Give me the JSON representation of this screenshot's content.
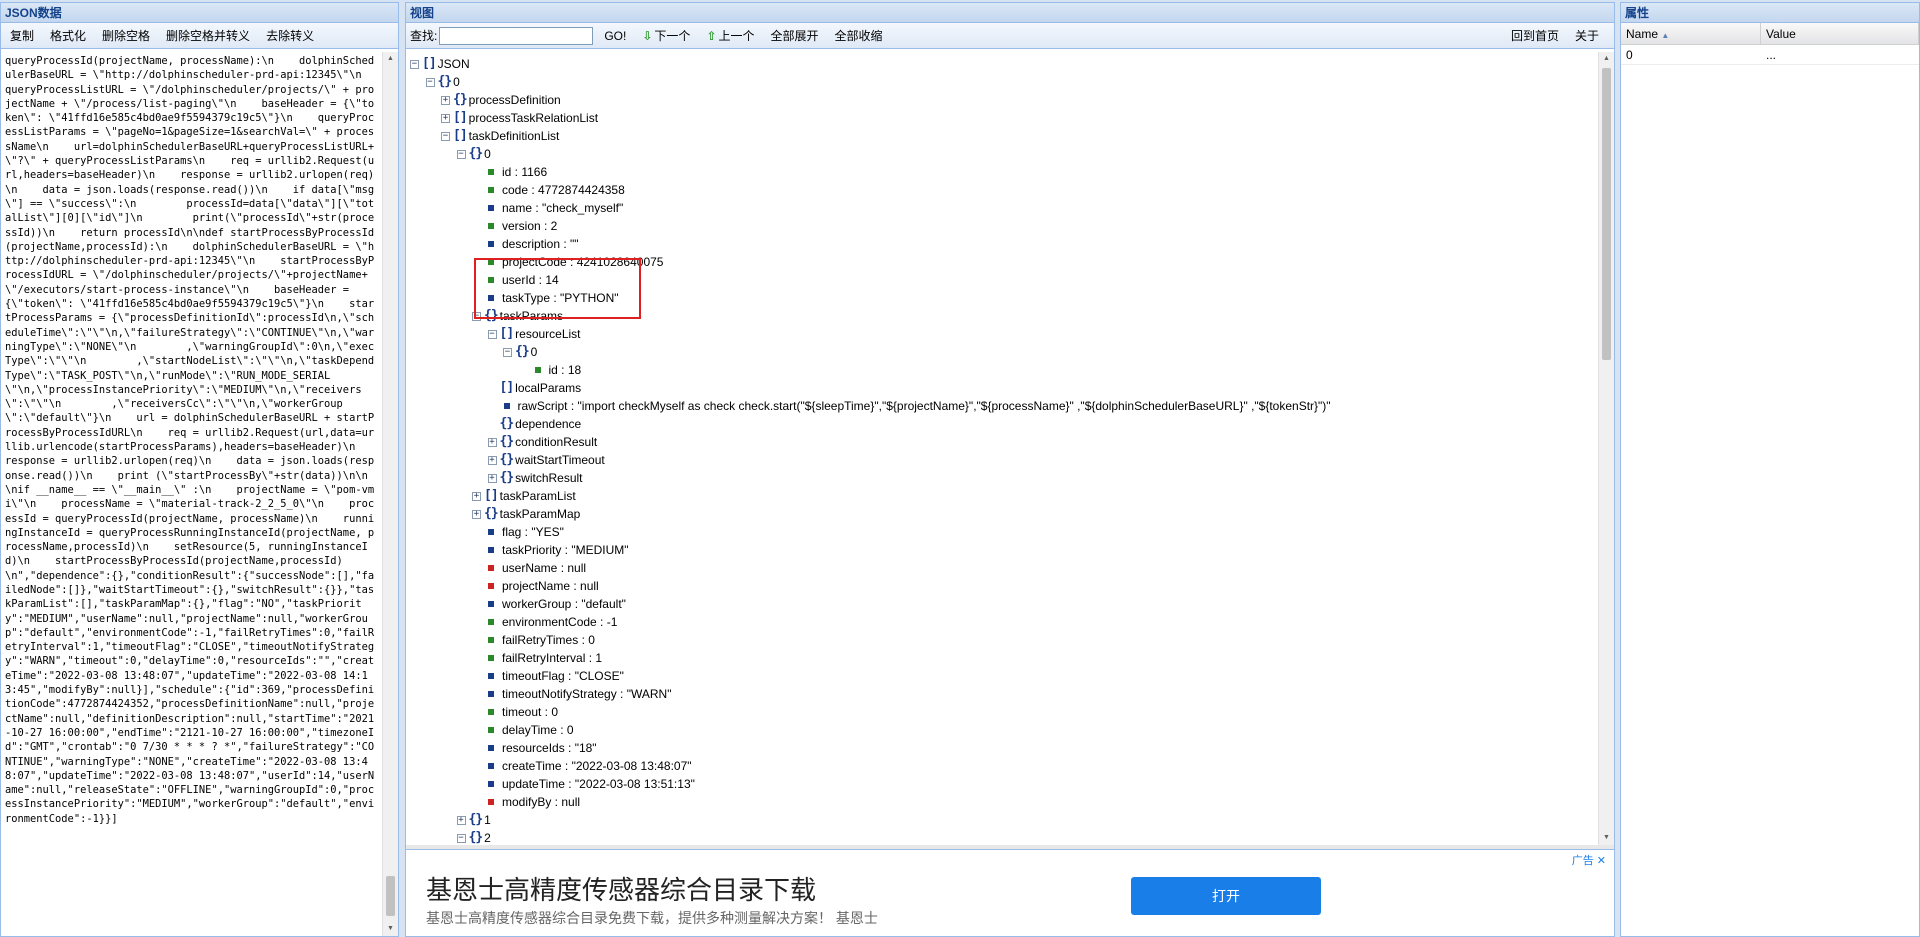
{
  "left_panel": {
    "title": "JSON数据",
    "toolbar": [
      "复制",
      "格式化",
      "删除空格",
      "删除空格并转义",
      "去除转义"
    ],
    "text": "queryProcessId(projectName, processName):\\n    dolphinSchedulerBaseURL = \\\"http://dolphinscheduler-prd-api:12345\\\"\\n    queryProcessListURL = \\\"/dolphinscheduler/projects/\\\" + projectName + \\\"/process/list-paging\\\"\\n    baseHeader = {\\\"token\\\": \\\"41ffd16e585c4bd0ae9f5594379c19c5\\\"}\\n    queryProcessListParams = \\\"pageNo=1&pageSize=1&searchVal=\\\" + processName\\n    url=dolphinSchedulerBaseURL+queryProcessListURL+\\\"?\\\" + queryProcessListParams\\n    req = urllib2.Request(url,headers=baseHeader)\\n    response = urllib2.urlopen(req)\\n    data = json.loads(response.read())\\n    if data[\\\"msg\\\"] == \\\"success\\\":\\n        processId=data[\\\"data\\\"][\\\"totalList\\\"][0][\\\"id\\\"]\\n        print(\\\"processId\\\"+str(processId))\\n    return processId\\n\\ndef startProcessByProcessId(projectName,processId):\\n    dolphinSchedulerBaseURL = \\\"http://dolphinscheduler-prd-api:12345\\\"\\n    startProcessByProcessIdURL = \\\"/dolphinscheduler/projects/\\\"+projectName+\\\"/executors/start-process-instance\\\"\\n    baseHeader = {\\\"token\\\": \\\"41ffd16e585c4bd0ae9f5594379c19c5\\\"}\\n    startProcessParams = {\\\"processDefinitionId\\\":processId\\n,\\\"scheduleTime\\\":\\\"\\\"\\n,\\\"failureStrategy\\\":\\\"CONTINUE\\\"\\n,\\\"warningType\\\":\\\"NONE\\\"\\n        ,\\\"warningGroupId\\\":0\\n,\\\"execType\\\":\\\"\\\"\\n        ,\\\"startNodeList\\\":\\\"\\\"\\n,\\\"taskDependType\\\":\\\"TASK_POST\\\"\\n,\\\"runMode\\\":\\\"RUN_MODE_SERIAL\\\"\\n,\\\"processInstancePriority\\\":\\\"MEDIUM\\\"\\n,\\\"receivers\\\":\\\"\\\"\\n        ,\\\"receiversCc\\\":\\\"\\\"\\n,\\\"workerGroup\\\":\\\"default\\\"}\\n    url = dolphinSchedulerBaseURL + startProcessByProcessIdURL\\n    req = urllib2.Request(url,data=urllib.urlencode(startProcessParams),headers=baseHeader)\\n    response = urllib2.urlopen(req)\\n    data = json.loads(response.read())\\n    print (\\\"startProcessBy\\\"+str(data))\\n\\n\\nif __name__ == \\\"__main__\\\" :\\n    projectName = \\\"pom-vmi\\\"\\n    processName = \\\"material-track-2_2_5_0\\\"\\n    processId = queryProcessId(projectName, processName)\\n    runningInstanceId = queryProcessRunningInstanceId(projectName, processName,processId)\\n    setResource(5, runningInstanceId)\\n    startProcessByProcessId(projectName,processId)\\n\",\"dependence\":{},\"conditionResult\":{\"successNode\":[],\"failedNode\":[]},\"waitStartTimeout\":{},\"switchResult\":{}},\"taskParamList\":[],\"taskParamMap\":{},\"flag\":\"NO\",\"taskPriority\":\"MEDIUM\",\"userName\":null,\"projectName\":null,\"workerGroup\":\"default\",\"environmentCode\":-1,\"failRetryTimes\":0,\"failRetryInterval\":1,\"timeoutFlag\":\"CLOSE\",\"timeoutNotifyStrategy\":\"WARN\",\"timeout\":0,\"delayTime\":0,\"resourceIds\":\"\",\"createTime\":\"2022-03-08 13:48:07\",\"updateTime\":\"2022-03-08 14:13:45\",\"modifyBy\":null}],\"schedule\":{\"id\":369,\"processDefinitionCode\":4772874424352,\"processDefinitionName\":null,\"projectName\":null,\"definitionDescription\":null,\"startTime\":\"2021-10-27 16:00:00\",\"endTime\":\"2121-10-27 16:00:00\",\"timezoneId\":\"GMT\",\"crontab\":\"0 7/30 * * * ? *\",\"failureStrategy\":\"CONTINUE\",\"warningType\":\"NONE\",\"createTime\":\"2022-03-08 13:48:07\",\"updateTime\":\"2022-03-08 13:48:07\",\"userId\":14,\"userName\":null,\"releaseState\":\"OFFLINE\",\"warningGroupId\":0,\"processInstancePriority\":\"MEDIUM\",\"workerGroup\":\"default\",\"environmentCode\":-1}}]"
  },
  "center_panel": {
    "title": "视图",
    "search_label": "查找:",
    "search_value": "",
    "go_label": "GO!",
    "next_label": "下一个",
    "prev_label": "上一个",
    "expand_all": "全部展开",
    "collapse_all": "全部收缩",
    "home_label": "回到首页",
    "about_label": "关于",
    "tree": [
      {
        "d": 0,
        "t": "-",
        "k": "arr",
        "l": "JSON"
      },
      {
        "d": 1,
        "t": "-",
        "k": "obj",
        "l": "0"
      },
      {
        "d": 2,
        "t": "+",
        "k": "obj",
        "l": "processDefinition"
      },
      {
        "d": 2,
        "t": "+",
        "k": "arr",
        "l": "processTaskRelationList"
      },
      {
        "d": 2,
        "t": "-",
        "k": "arr",
        "l": "taskDefinitionList"
      },
      {
        "d": 3,
        "t": "-",
        "k": "obj",
        "l": "0"
      },
      {
        "d": 4,
        "t": "",
        "k": "num",
        "l": "id : 1166"
      },
      {
        "d": 4,
        "t": "",
        "k": "num",
        "l": "code : 4772874424358"
      },
      {
        "d": 4,
        "t": "",
        "k": "str",
        "l": "name : \"check_myself\""
      },
      {
        "d": 4,
        "t": "",
        "k": "num",
        "l": "version : 2"
      },
      {
        "d": 4,
        "t": "",
        "k": "str",
        "l": "description : \"\""
      },
      {
        "d": 4,
        "t": "",
        "k": "num",
        "l": "projectCode : 4241028640075"
      },
      {
        "d": 4,
        "t": "",
        "k": "num",
        "l": "userId : 14"
      },
      {
        "d": 4,
        "t": "",
        "k": "str",
        "l": "taskType : \"PYTHON\""
      },
      {
        "d": 4,
        "t": "-",
        "k": "obj",
        "l": "taskParams"
      },
      {
        "d": 5,
        "t": "-",
        "k": "arr",
        "l": "resourceList"
      },
      {
        "d": 6,
        "t": "-",
        "k": "obj",
        "l": "0"
      },
      {
        "d": 7,
        "t": "",
        "k": "num",
        "l": "id : 18"
      },
      {
        "d": 5,
        "t": "",
        "k": "arr",
        "l": "localParams"
      },
      {
        "d": 5,
        "t": "",
        "k": "str",
        "l": "rawScript : \"import checkMyself as check check.start(\"${sleepTime}\",\"${projectName}\",\"${processName}\" ,\"${dolphinSchedulerBaseURL}\" ,\"${tokenStr}\")\""
      },
      {
        "d": 5,
        "t": "",
        "k": "obj",
        "l": "dependence"
      },
      {
        "d": 5,
        "t": "+",
        "k": "obj",
        "l": "conditionResult"
      },
      {
        "d": 5,
        "t": "+",
        "k": "obj",
        "l": "waitStartTimeout"
      },
      {
        "d": 5,
        "t": "+",
        "k": "obj",
        "l": "switchResult"
      },
      {
        "d": 4,
        "t": "+",
        "k": "arr",
        "l": "taskParamList"
      },
      {
        "d": 4,
        "t": "+",
        "k": "obj",
        "l": "taskParamMap"
      },
      {
        "d": 4,
        "t": "",
        "k": "str",
        "l": "flag : \"YES\""
      },
      {
        "d": 4,
        "t": "",
        "k": "str",
        "l": "taskPriority : \"MEDIUM\""
      },
      {
        "d": 4,
        "t": "",
        "k": "null",
        "l": "userName : null"
      },
      {
        "d": 4,
        "t": "",
        "k": "null",
        "l": "projectName : null"
      },
      {
        "d": 4,
        "t": "",
        "k": "str",
        "l": "workerGroup : \"default\""
      },
      {
        "d": 4,
        "t": "",
        "k": "num",
        "l": "environmentCode : -1"
      },
      {
        "d": 4,
        "t": "",
        "k": "num",
        "l": "failRetryTimes : 0"
      },
      {
        "d": 4,
        "t": "",
        "k": "num",
        "l": "failRetryInterval : 1"
      },
      {
        "d": 4,
        "t": "",
        "k": "str",
        "l": "timeoutFlag : \"CLOSE\""
      },
      {
        "d": 4,
        "t": "",
        "k": "str",
        "l": "timeoutNotifyStrategy : \"WARN\""
      },
      {
        "d": 4,
        "t": "",
        "k": "num",
        "l": "timeout : 0"
      },
      {
        "d": 4,
        "t": "",
        "k": "num",
        "l": "delayTime : 0"
      },
      {
        "d": 4,
        "t": "",
        "k": "str",
        "l": "resourceIds : \"18\""
      },
      {
        "d": 4,
        "t": "",
        "k": "str",
        "l": "createTime : \"2022-03-08 13:48:07\""
      },
      {
        "d": 4,
        "t": "",
        "k": "str",
        "l": "updateTime : \"2022-03-08 13:51:13\""
      },
      {
        "d": 4,
        "t": "",
        "k": "null",
        "l": "modifyBy : null"
      },
      {
        "d": 3,
        "t": "+",
        "k": "obj",
        "l": "1"
      },
      {
        "d": 3,
        "t": "-",
        "k": "obj",
        "l": "2"
      }
    ]
  },
  "ad": {
    "title": "基恩士高精度传感器综合目录下载",
    "desc": "基恩士高精度传感器综合目录免费下载，提供多种测量解决方案！ 基恩士",
    "button": "打开",
    "badge": "广告"
  },
  "right_panel": {
    "title": "属性",
    "col_name": "Name",
    "col_value": "Value",
    "rows": [
      {
        "name": "0",
        "value": "..."
      }
    ]
  },
  "colors": {
    "number_dot": "#2a8a2a",
    "string_dot": "#1a3d8a",
    "null_dot": "#cc2222",
    "highlight": "#e02020"
  }
}
